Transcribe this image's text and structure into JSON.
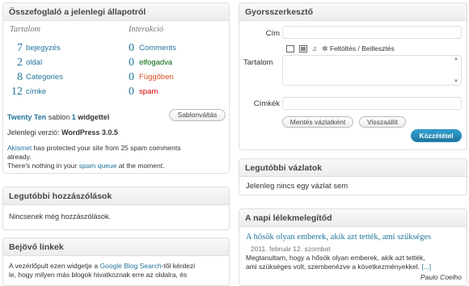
{
  "summary": {
    "title": "Összefoglaló a jelenlegi állapotról",
    "content_heading": "Tartalom",
    "interaction_heading": "Interakció",
    "content_rows": [
      {
        "count": "7",
        "label": "bejegyzés"
      },
      {
        "count": "2",
        "label": "oldal"
      },
      {
        "count": "8",
        "label": "Categories"
      },
      {
        "count": "12",
        "label": "címke"
      }
    ],
    "interaction_rows": [
      {
        "count": "0",
        "label": "Comments"
      },
      {
        "count": "0",
        "label": "elfogadva"
      },
      {
        "count": "0",
        "label": "Függőben"
      },
      {
        "count": "0",
        "label": "spam"
      }
    ],
    "theme_name": "Twenty Ten",
    "theme_text": "sablon",
    "widget_count": "1",
    "widget_word": "widgettel",
    "switch_theme": "Sablonváltás",
    "version_label": "Jelenlegi verzió:",
    "version_value": "WordPress 3.0.5",
    "akismet_link": "Akismet",
    "akismet_text": "has protected your site from 25 spam comments",
    "akismet_text2": "already.",
    "queue_text1": "There's nothing in your",
    "queue_link": "spam queue",
    "queue_text2": "at the moment."
  },
  "recent_comments": {
    "title": "Legutóbbi hozzászólások",
    "empty": "Nincsenek még hozzászólások."
  },
  "incoming_links": {
    "title": "Bejövő linkek",
    "line1_a": "A vezérlőpult ezen widgetje a",
    "line1_link": "Google Blog Search",
    "line1_b": "-től kérdezi",
    "line2": "le, hogy milyen más blogok hivatkoznak erre az oldalra, és"
  },
  "quickpress": {
    "title": "Gyorsszerkesztő",
    "title_label": "Cím",
    "content_label": "Tartalom",
    "upload_label": "Feltöltés / Beillesztés",
    "tags_label": "Címkék",
    "save_draft": "Mentés vázlatként",
    "reset": "Visszaállít",
    "publish": "Közzététel"
  },
  "recent_drafts": {
    "title": "Legutóbbi vázlatok",
    "empty": "Jelenleg nincs egy vázlat sem"
  },
  "daily": {
    "title": "A napi lélekmelegítőd",
    "post_title": "A hősök olyan emberek, akik azt tették, ami szükséges",
    "date": "2011. február 12. szombat",
    "line1": "Megtanultam, hogy a hősök olyan emberek, akik azt tették,",
    "line2": "ami szükséges volt, szembenézve a következményekkel.",
    "more": "[...]",
    "author": "Paulo Coelho"
  }
}
